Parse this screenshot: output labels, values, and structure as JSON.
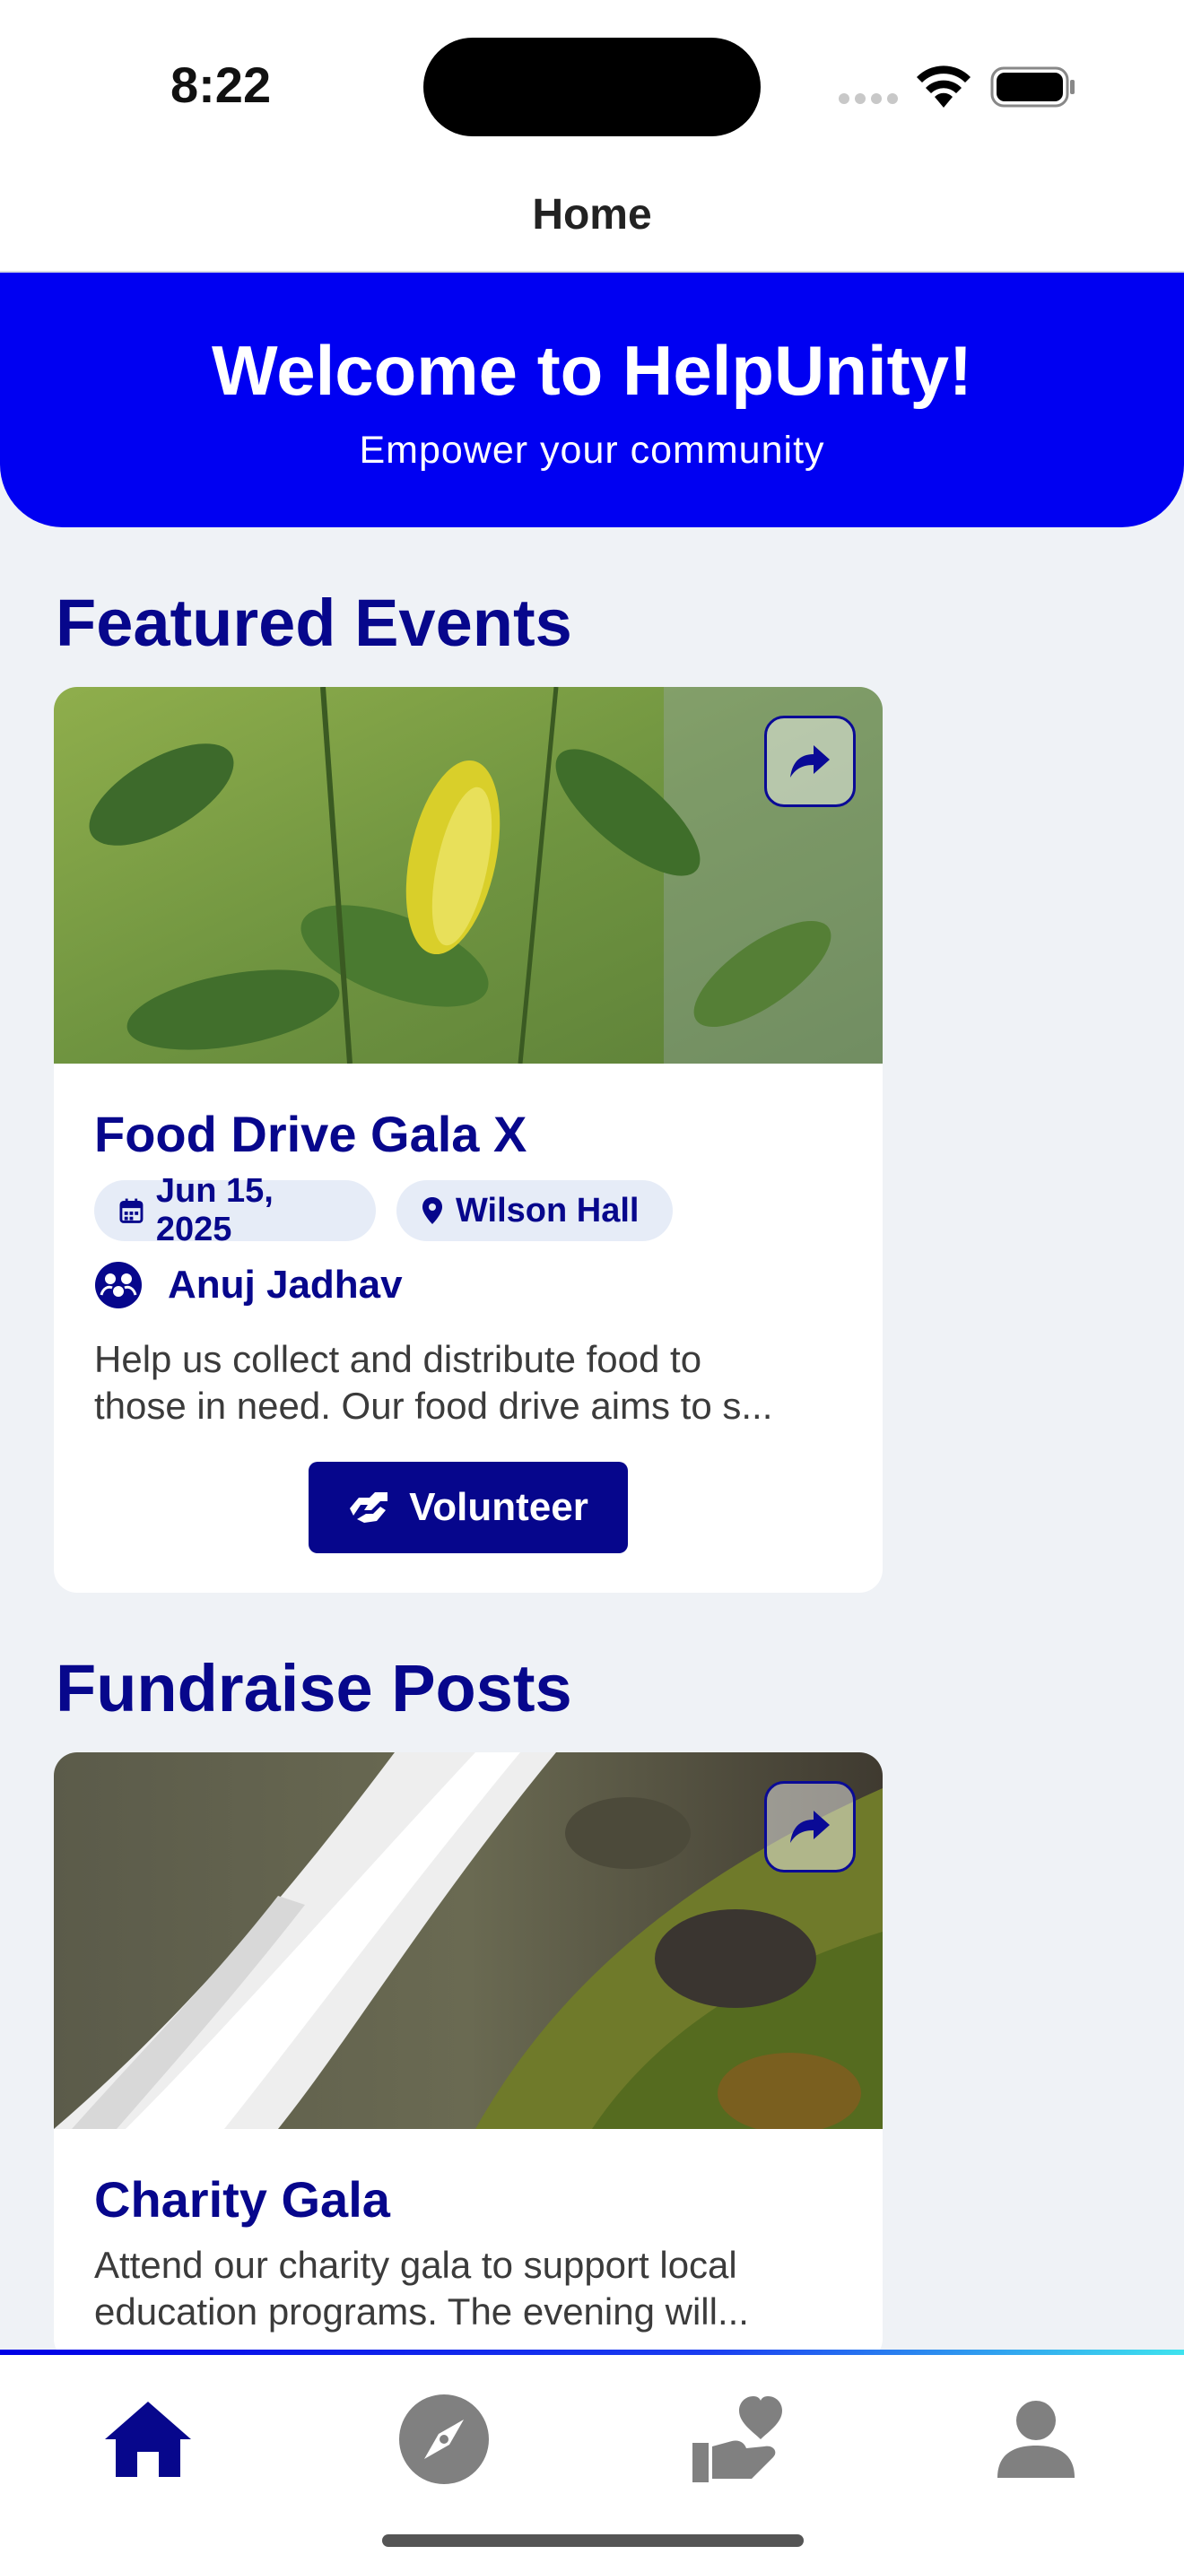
{
  "status_bar": {
    "time": "8:22"
  },
  "nav": {
    "title": "Home"
  },
  "hero": {
    "title": "Welcome to HelpUnity!",
    "subtitle": "Empower your community"
  },
  "featured_events": {
    "heading": "Featured Events",
    "card": {
      "title": "Food Drive Gala X",
      "date": "Jun 15, 2025",
      "location": "Wilson Hall",
      "organizer": "Anuj Jadhav",
      "description_line1": "Help us collect and distribute food to",
      "description_line2": "those in need. Our food drive aims to s...",
      "action_label": "Volunteer"
    }
  },
  "fundraise_posts": {
    "heading": "Fundraise Posts",
    "card": {
      "title": "Charity Gala",
      "description_line1": "Attend our charity gala to support local",
      "description_line2": "education programs. The evening will..."
    }
  },
  "tab_bar": {
    "items": [
      {
        "name": "home",
        "icon": "home-icon",
        "active": true
      },
      {
        "name": "explore",
        "icon": "compass-icon",
        "active": false
      },
      {
        "name": "donate",
        "icon": "hand-heart-icon",
        "active": false
      },
      {
        "name": "profile",
        "icon": "person-icon",
        "active": false
      }
    ]
  },
  "colors": {
    "brand_blue": "#0000f2",
    "navy_text": "#07078c",
    "background": "#eff2f6",
    "tab_inactive": "#808080"
  }
}
